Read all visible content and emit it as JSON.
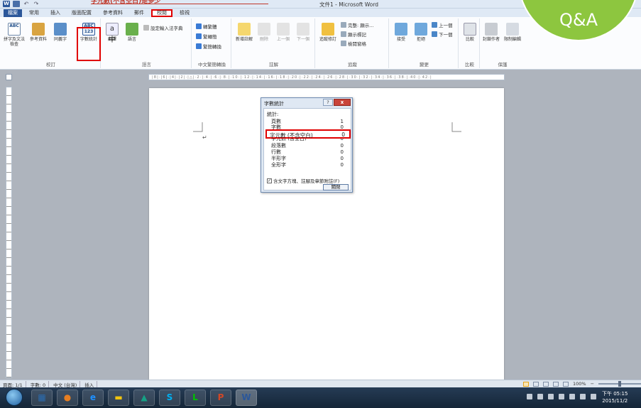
{
  "window": {
    "title": "文件1 - Microsoft Word",
    "caption_top": "字元數(不含空白)是多少"
  },
  "badge": {
    "text": "Q&A",
    "color": "#8dc63f"
  },
  "tabs": [
    {
      "label": "檔案"
    },
    {
      "label": "常用"
    },
    {
      "label": "插入"
    },
    {
      "label": "版面配置"
    },
    {
      "label": "參考資料"
    },
    {
      "label": "郵件"
    },
    {
      "label": "校閱"
    },
    {
      "label": "檢視"
    }
  ],
  "ribbon": {
    "proofing": {
      "label": "校訂",
      "spelling": "拼字及文法檢查",
      "research": "參考資料",
      "thesaurus": "同義字",
      "word_count": "字數統計",
      "word_count_icon_text": "ABC 123"
    },
    "language": {
      "label": "語言",
      "translate": "翻譯",
      "language": "語言",
      "translate_input": "設定輸入法字典"
    },
    "chinese": {
      "label": "中文繁簡轉換",
      "to_trad": "轉繁體",
      "to_simp": "繁轉簡",
      "convert": "繁簡轉換"
    },
    "comments": {
      "label": "註解",
      "new_comment": "新增註解",
      "delete": "刪除",
      "previous": "上一個",
      "next": "下一個"
    },
    "tracking": {
      "label": "追蹤",
      "track_changes": "追蹤修訂",
      "final_show": "完整: 顯示...",
      "show_markup": "顯示標記",
      "review_pane": "檢閱窗格"
    },
    "changes": {
      "label": "變更",
      "accept": "接受",
      "reject": "拒絕",
      "prev": "上一個",
      "next": "下一個"
    },
    "compare": {
      "label": "比較",
      "compare": "比較"
    },
    "protect": {
      "label": "保護",
      "block_authors": "封鎖作者",
      "restrict": "限制編輯"
    }
  },
  "ruler_text": "|8|·|6|·|4|·|2|·|△|·2·|·4·|·6·|·8·|·10·|·12·|·14·|·16·|·18·|·20·|·22·|·24·|·26·|·28·|·30·|·32·|·34·|·36·|·38·|·40·|·42·|",
  "document": {
    "cursor_mark": "↵"
  },
  "dialog": {
    "title": "字數統計",
    "help": "?",
    "close_x": "x",
    "stats_header": "統計:",
    "rows": [
      {
        "label": "頁數",
        "value": "1"
      },
      {
        "label": "字數",
        "value": "0"
      },
      {
        "label": "字元數 (不含空白)",
        "value": "0"
      },
      {
        "label": "字元數 (含空白)",
        "value": "0"
      },
      {
        "label": "段落數",
        "value": "0"
      },
      {
        "label": "行數",
        "value": "0"
      },
      {
        "label": "半形字",
        "value": "0"
      },
      {
        "label": "全形字",
        "value": "0"
      }
    ],
    "checkbox_label": "含文字方塊、註腳及章節附註(F)",
    "checkbox_mark": "✓",
    "close_button": "關閉"
  },
  "statusbar": {
    "page": "頁面: 1/1",
    "words": "字數: 0",
    "language": "中文 (台灣)",
    "mode": "插入",
    "zoom": "100%",
    "zoom_minus": "−",
    "zoom_plus": "+"
  },
  "taskbar": {
    "apps": [
      {
        "icon": "file-manager-icon",
        "glyph": "▦",
        "color": "#2b6cb0"
      },
      {
        "icon": "media-player-icon",
        "glyph": "●",
        "color": "#e67e22"
      },
      {
        "icon": "internet-explorer-icon",
        "glyph": "e",
        "color": "#1e90ff"
      },
      {
        "icon": "folder-icon",
        "glyph": "▬",
        "color": "#f1c40f"
      },
      {
        "icon": "photos-icon",
        "glyph": "▲",
        "color": "#16a085"
      },
      {
        "icon": "skype-icon",
        "glyph": "S",
        "color": "#00aff0"
      },
      {
        "icon": "line-icon",
        "glyph": "L",
        "color": "#00c300"
      },
      {
        "icon": "powerpoint-icon",
        "glyph": "P",
        "color": "#d24726"
      },
      {
        "icon": "word-icon",
        "glyph": "W",
        "color": "#2b579a"
      }
    ],
    "time": "下午 05:15",
    "date": "2015/11/2"
  }
}
